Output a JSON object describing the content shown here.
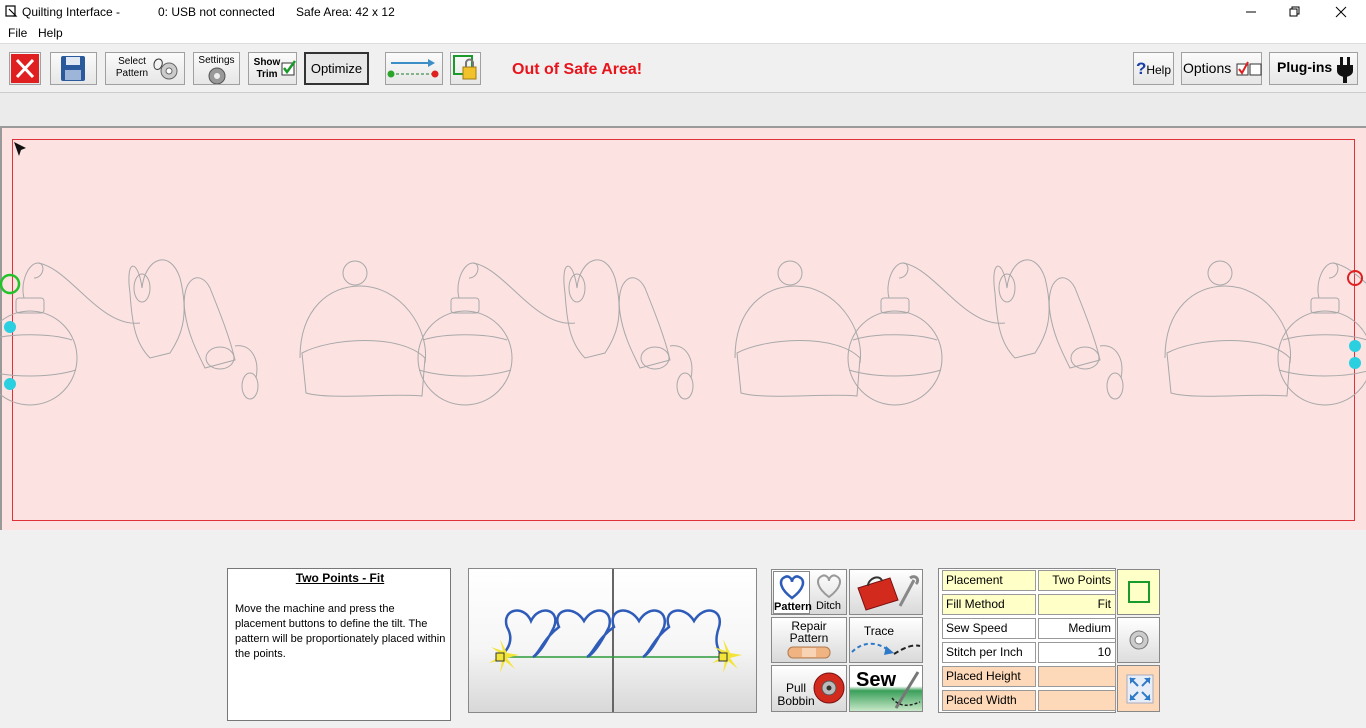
{
  "window": {
    "app_title": "Quilting Interface  -",
    "usb_status": "0: USB not connected",
    "safe_area": "Safe Area:  42 x 12"
  },
  "menu": {
    "items": [
      "File",
      "Help"
    ]
  },
  "toolbar": {
    "select_pattern_line1": "Select",
    "select_pattern_line2": "Pattern",
    "settings_label": "Settings",
    "show_trim_line1": "Show",
    "show_trim_line2": "Trim",
    "optimize_label": "Optimize",
    "status_message": "Out of Safe Area!",
    "help_label": "Help",
    "options_label": "Options",
    "plugins_label": "Plug-ins",
    "status_color": "#e8141c"
  },
  "info": {
    "title": "Two Points - Fit",
    "text": "Move the machine and press the placement buttons to define the tilt. The pattern will be proportionately placed within the points."
  },
  "tools": {
    "pattern_label": "Pattern",
    "ditch_label": "Ditch",
    "repair_line1": "Repair",
    "repair_line2": "Pattern",
    "trace_label": "Trace",
    "pull_line1": "Pull",
    "pull_line2": "Bobbin",
    "sew_label": "Sew"
  },
  "properties": [
    {
      "label": "Placement",
      "value": "Two Points",
      "bg": "#ffffc8"
    },
    {
      "label": "Fill Method",
      "value": "Fit",
      "bg": "#ffffc8"
    },
    {
      "label": "Sew Speed",
      "value": "Medium",
      "bg": "#ffffff"
    },
    {
      "label": "Stitch per Inch",
      "value": "10",
      "bg": "#ffffff"
    },
    {
      "label": "Placed Height",
      "value": "",
      "bg": "#fdd9b9"
    },
    {
      "label": "Placed Width",
      "value": "",
      "bg": "#fdd9b9"
    }
  ]
}
